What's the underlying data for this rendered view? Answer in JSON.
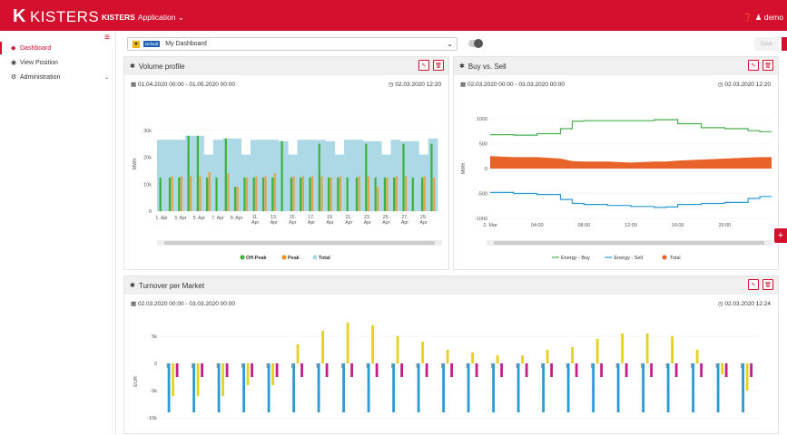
{
  "header": {
    "logo_mark": "K",
    "logo_text": "KISTERS",
    "app_brand": "KISTERS",
    "app_label": "Application ⌄",
    "user": "❓ ♟ demo"
  },
  "sidebar": {
    "items": [
      {
        "icon": "◆",
        "label": "Dashboard"
      },
      {
        "icon": "◉",
        "label": "View Position"
      },
      {
        "icon": "⚙",
        "label": "Administration",
        "chevron": "⌄"
      }
    ]
  },
  "toolbar": {
    "star": "★",
    "badge": "Default",
    "dashboard_name": "My Dashboard",
    "caret": "⌄",
    "save_label": "Save"
  },
  "panels": {
    "volume": {
      "title": "Volume profile",
      "dates": "01.04.2020 00:00 - 01.05.2020 00:00",
      "stamp": "02.03.2020 12:20"
    },
    "buysell": {
      "title": "Buy vs. Sell",
      "dates": "02.03.2020 00:00 - 03.03.2020 00:00",
      "stamp": "02.03.2020 12:20"
    },
    "turnover": {
      "title": "Turnover per Market",
      "dates": "02.03.2020 00:00 - 03.03.2020 00:00",
      "stamp": "02.03.2020 12:24"
    }
  },
  "icons": {
    "gear": "✱",
    "edit": "✎",
    "delete": "🗑",
    "calendar": "▦",
    "clock": "◷",
    "add": "+"
  },
  "colors": {
    "brand": "#d5102e",
    "offpeak": "#3cb43c",
    "peak": "#f5921e",
    "total": "#add8e6",
    "buy": "#4caf50",
    "sell": "#2b9bd6",
    "buysell_total": "#e8632a",
    "yellow": "#e6d21e",
    "magenta": "#c41e8c"
  },
  "chart_data": [
    {
      "type": "bar",
      "title": "Volume profile",
      "ylabel": "MWh",
      "ylim": [
        0,
        35000
      ],
      "yticks": [
        "0",
        "10k",
        "20k",
        "30k"
      ],
      "xtick_labels": [
        "1. Apr",
        "3. Apr",
        "5. Apr",
        "7. Apr",
        "9. Apr",
        "11. Apr",
        "13. Apr",
        "15. Apr",
        "17. Apr",
        "19. Apr",
        "21. Apr",
        "23. Apr",
        "25. Apr",
        "27. Apr",
        "29. Apr"
      ],
      "series": [
        {
          "name": "Off-Peak",
          "values": [
            12500,
            12500,
            12500,
            28000,
            28000,
            12500,
            12500,
            27000,
            9000,
            12500,
            12500,
            12500,
            12500,
            26000,
            12500,
            12500,
            12500,
            25000,
            12500,
            12500,
            12500,
            12500,
            25000,
            12500,
            12500,
            12500,
            25000,
            12500,
            12500,
            25000
          ]
        },
        {
          "name": "Peak",
          "values": [
            0,
            13000,
            13000,
            13000,
            13000,
            14500,
            0,
            14000,
            9000,
            12500,
            13000,
            13000,
            14000,
            0,
            13000,
            13000,
            13000,
            13000,
            12500,
            13000,
            0,
            13000,
            13000,
            9000,
            12500,
            13000,
            13000,
            0,
            13000,
            12500
          ]
        },
        {
          "name": "Total",
          "values": [
            26500,
            26500,
            26500,
            28000,
            28000,
            21000,
            26500,
            27000,
            27000,
            21000,
            26500,
            26500,
            26500,
            26000,
            21000,
            26500,
            26500,
            26500,
            26000,
            21000,
            26500,
            26500,
            26000,
            26000,
            21000,
            26500,
            26000,
            26000,
            21000,
            27000
          ]
        }
      ],
      "legend": "bottom"
    },
    {
      "type": "line",
      "title": "Buy vs. Sell",
      "ylabel": "MWh",
      "ylim": [
        -1000,
        1000
      ],
      "yticks": [
        "-1000",
        "-500",
        "0",
        "500",
        "1000"
      ],
      "xtick_labels": [
        "2. Mar",
        "04:00",
        "08:00",
        "12:00",
        "16:00",
        "20:00"
      ],
      "hours": [
        0,
        2,
        4,
        6,
        7,
        8,
        10,
        12,
        14,
        15,
        16,
        18,
        20,
        22,
        23
      ],
      "series": [
        {
          "name": "Energy - Buy",
          "values": [
            680,
            670,
            700,
            800,
            950,
            960,
            960,
            960,
            980,
            980,
            900,
            820,
            800,
            760,
            740
          ]
        },
        {
          "name": "Energy - Sell",
          "values": [
            -480,
            -500,
            -520,
            -620,
            -700,
            -720,
            -740,
            -760,
            -780,
            -770,
            -720,
            -700,
            -680,
            -600,
            -560
          ]
        },
        {
          "name": "Total",
          "values": [
            250,
            230,
            230,
            200,
            150,
            140,
            140,
            120,
            140,
            140,
            160,
            180,
            200,
            220,
            230
          ]
        }
      ],
      "legend": "bottom"
    },
    {
      "type": "bar",
      "title": "Turnover per Market",
      "ylabel": "EUR",
      "ylim": [
        -10000,
        8000
      ],
      "yticks": [
        "-10k",
        "-5k",
        "0",
        "5k"
      ],
      "groups": 24,
      "series": [
        {
          "name": "",
          "values": [
            -9000,
            -9000,
            -9000,
            -9000,
            -9000,
            -9000,
            -9000,
            -9000,
            -9000,
            -9000,
            -9000,
            -9000,
            -9000,
            -9000,
            -9000,
            -9000,
            -9000,
            -9000,
            -9000,
            -9000,
            -9000,
            -9000,
            -9000,
            -9000
          ]
        },
        {
          "name": "",
          "values": [
            -6000,
            -6000,
            -6000,
            -4000,
            -4000,
            3500,
            6000,
            7500,
            7000,
            5000,
            4000,
            2500,
            2000,
            1500,
            1500,
            2500,
            3000,
            4500,
            5500,
            5500,
            5000,
            2500,
            -2000,
            -5000
          ]
        },
        {
          "name": "",
          "values": [
            -2500,
            -2500,
            -2500,
            -2500,
            -2500,
            -2500,
            -2500,
            -2500,
            -2500,
            -2500,
            -2500,
            -2500,
            -2500,
            -2500,
            -2500,
            -2500,
            -2500,
            -2500,
            -2500,
            -2500,
            -2500,
            -2500,
            -2500,
            -2500
          ]
        }
      ]
    }
  ]
}
